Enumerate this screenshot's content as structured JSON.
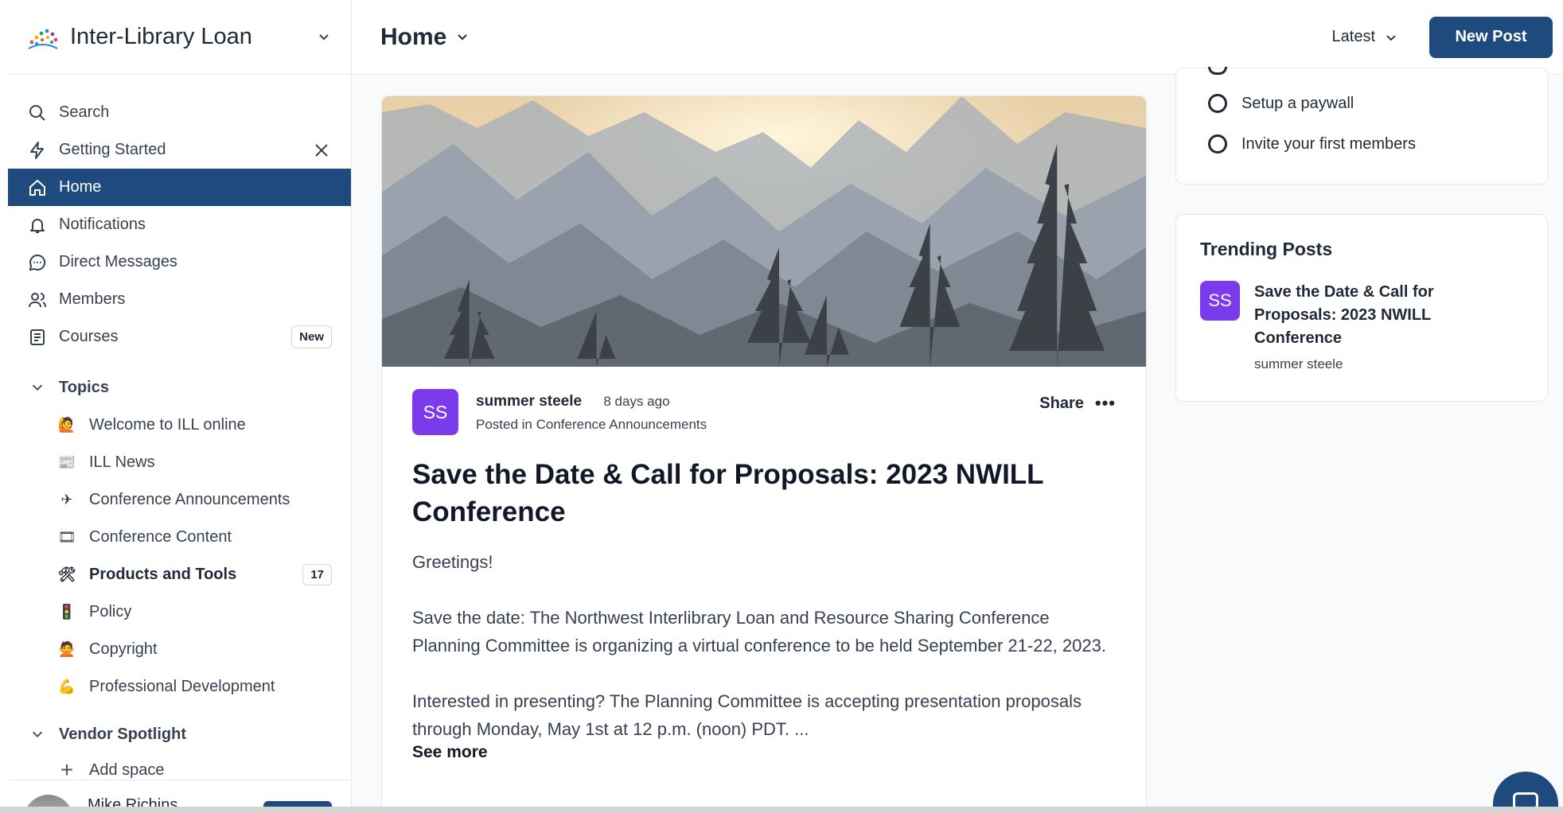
{
  "sidebar": {
    "brand": "Inter-Library Loan",
    "nav": [
      {
        "label": "Search",
        "icon": "search-icon"
      },
      {
        "label": "Getting Started",
        "icon": "lightning-icon"
      },
      {
        "label": "Home",
        "icon": "home-icon"
      },
      {
        "label": "Notifications",
        "icon": "bell-icon"
      },
      {
        "label": "Direct Messages",
        "icon": "chat-bubble-icon"
      },
      {
        "label": "Members",
        "icon": "members-icon"
      },
      {
        "label": "Courses",
        "icon": "courses-icon",
        "badge": "New"
      }
    ],
    "topics_heading": "Topics",
    "topics": [
      {
        "label": "Welcome to ILL online",
        "emoji": "🙋"
      },
      {
        "label": "ILL News",
        "emoji": "📰"
      },
      {
        "label": "Conference Announcements",
        "emoji": "✈"
      },
      {
        "label": "Conference Content",
        "emoji": "🎞"
      },
      {
        "label": "Products and Tools",
        "emoji": "🛠",
        "count": "17"
      },
      {
        "label": "Policy",
        "emoji": "🚦"
      },
      {
        "label": "Copyright",
        "emoji": "🙅"
      },
      {
        "label": "Professional Development",
        "emoji": "💪"
      }
    ],
    "vendor_heading": "Vendor Spotlight",
    "add_space": "Add space",
    "user_name": "Mike Richins"
  },
  "topbar": {
    "title": "Home",
    "sort": "Latest",
    "new_post": "New Post"
  },
  "post": {
    "avatar_initials": "SS",
    "author": "summer steele",
    "time": "8 days ago",
    "posted_in": "Posted in Conference Announcements",
    "share": "Share",
    "more": "•••",
    "title": "Save the Date & Call for Proposals: 2023 NWILL Conference",
    "paragraphs": [
      "Greetings!",
      "Save the date: The Northwest Interlibrary Loan and Resource Sharing Conference Planning Committee is organizing a virtual conference to be held September 21-22, 2023.",
      "Interested in presenting? The Planning Committee is accepting presentation proposals through Monday, May 1st at 12 p.m. (noon) PDT. ..."
    ],
    "see_more": "See more"
  },
  "checklist": {
    "items": [
      "Setup a paywall",
      "Invite your first members"
    ]
  },
  "trending": {
    "heading": "Trending Posts",
    "items": [
      {
        "initials": "SS",
        "title": "Save the Date & Call for Proposals: 2023 NWILL Conference",
        "author": "summer steele"
      }
    ]
  },
  "colors": {
    "brand": "#1e4a7e",
    "avatar": "#7c3aed"
  }
}
